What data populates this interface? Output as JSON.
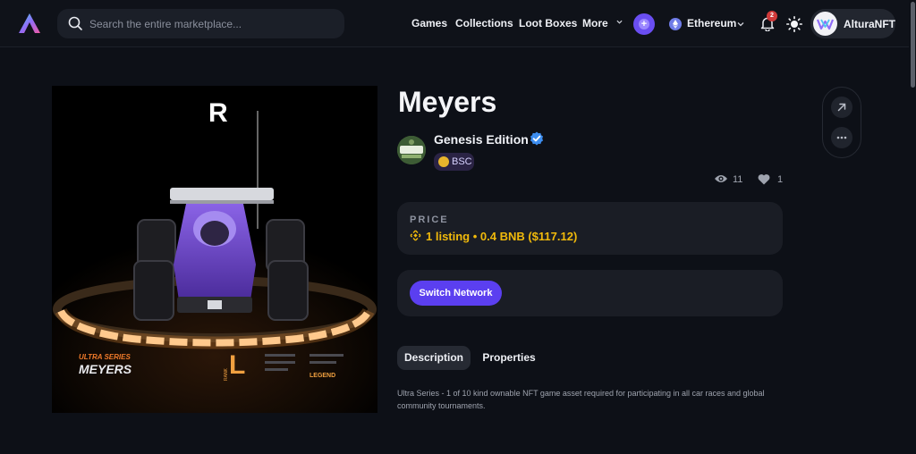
{
  "nav": {
    "search_placeholder": "Search the entire marketplace...",
    "links": [
      "Games",
      "Collections",
      "Loot Boxes",
      "More"
    ],
    "network": "Ethereum",
    "notification_count": "2",
    "account_name": "AlturaNFT",
    "plus_symbol": "+"
  },
  "item": {
    "title": "Meyers",
    "collection": "Genesis Edition",
    "chain": "BSC",
    "views": "11",
    "likes": "1"
  },
  "artwork": {
    "brand_letter": "R",
    "series": "ULTRA SERIES",
    "name": "MEYERS",
    "rank_letter": "L",
    "rank_word": "RANK",
    "rank_tier": "LEGEND"
  },
  "price": {
    "label": "PRICE",
    "value": "1 listing • 0.4 BNB ($117.12)"
  },
  "actions": {
    "switch_network": "Switch Network"
  },
  "tabs": [
    "Description",
    "Properties"
  ],
  "description": "Ultra Series - 1 of 10 kind ownable NFT game asset required for participating in all car races and global community tournaments.",
  "colors": {
    "accent": "#5b3ff0",
    "price": "#f0b90b",
    "background": "#0d1017"
  }
}
